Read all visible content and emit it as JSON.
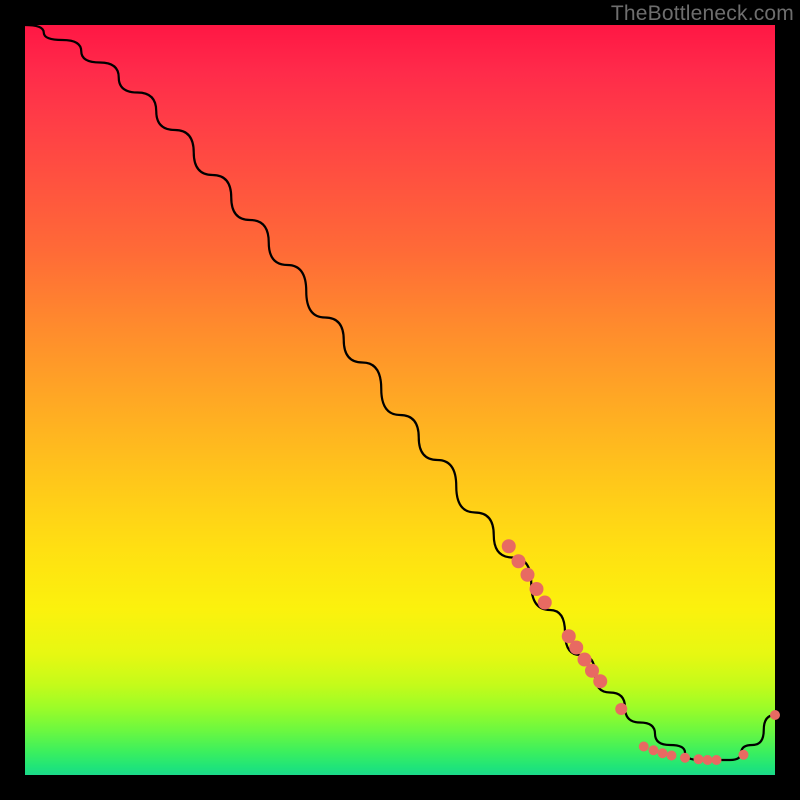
{
  "watermark": "TheBottleneck.com",
  "chart_data": {
    "type": "line",
    "title": "",
    "xlabel": "",
    "ylabel": "",
    "xlim": [
      0,
      100
    ],
    "ylim": [
      0,
      100
    ],
    "grid": false,
    "legend": false,
    "curve": {
      "name": "bottleneck-curve",
      "color": "#000000",
      "x": [
        0,
        5,
        10,
        15,
        20,
        25,
        30,
        35,
        40,
        45,
        50,
        55,
        60,
        65,
        70,
        74,
        78,
        82,
        86,
        90,
        94,
        97,
        100
      ],
      "y": [
        100,
        98,
        95,
        91,
        86,
        80,
        74,
        68,
        61,
        55,
        48,
        42,
        35,
        29,
        22,
        16,
        11,
        7,
        4,
        2,
        2,
        4,
        8
      ]
    },
    "markers": {
      "name": "highlight-dots",
      "color": "#e86a62",
      "radius": 6,
      "points": [
        {
          "x": 64.5,
          "y": 30.5,
          "r": 7
        },
        {
          "x": 65.8,
          "y": 28.5,
          "r": 7
        },
        {
          "x": 67.0,
          "y": 26.7,
          "r": 7
        },
        {
          "x": 68.2,
          "y": 24.8,
          "r": 7
        },
        {
          "x": 69.3,
          "y": 23.0,
          "r": 7
        },
        {
          "x": 72.5,
          "y": 18.5,
          "r": 7
        },
        {
          "x": 73.5,
          "y": 17.0,
          "r": 7
        },
        {
          "x": 74.6,
          "y": 15.4,
          "r": 7
        },
        {
          "x": 75.6,
          "y": 13.9,
          "r": 7
        },
        {
          "x": 76.7,
          "y": 12.5,
          "r": 7
        },
        {
          "x": 79.5,
          "y": 8.8,
          "r": 6
        },
        {
          "x": 82.5,
          "y": 3.8,
          "r": 5
        },
        {
          "x": 83.8,
          "y": 3.3,
          "r": 5
        },
        {
          "x": 85.0,
          "y": 2.9,
          "r": 5
        },
        {
          "x": 86.2,
          "y": 2.6,
          "r": 5
        },
        {
          "x": 88.0,
          "y": 2.3,
          "r": 5
        },
        {
          "x": 89.8,
          "y": 2.1,
          "r": 5
        },
        {
          "x": 91.0,
          "y": 2.0,
          "r": 5
        },
        {
          "x": 92.2,
          "y": 2.0,
          "r": 5
        },
        {
          "x": 95.8,
          "y": 2.7,
          "r": 5
        },
        {
          "x": 100.0,
          "y": 8.0,
          "r": 5
        }
      ]
    }
  }
}
